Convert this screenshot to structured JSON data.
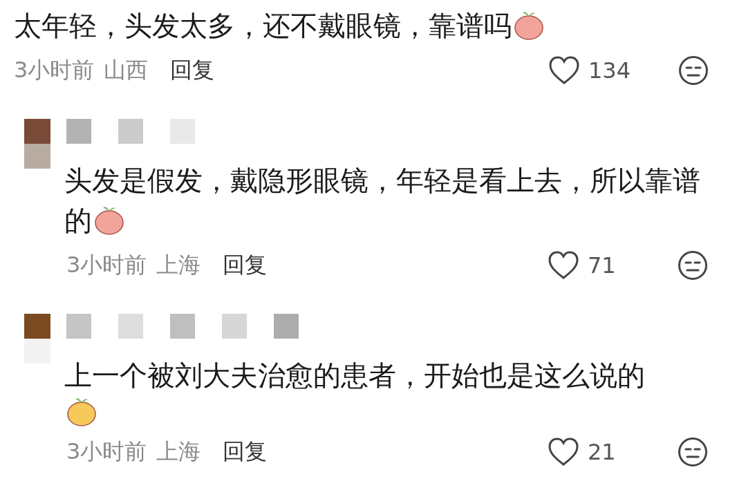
{
  "comment": {
    "text": "太年轻，头发太多，还不戴眼镜，靠谱吗",
    "sticker": {
      "color": "#f2a49a"
    },
    "time": "3小时前",
    "location": "山西",
    "reply_label": "回复",
    "likes": "134"
  },
  "replies": [
    {
      "text": "头发是假发，戴隐形眼镜，年轻是看上去，所以靠谱的",
      "sticker": {
        "color": "#f2a49a"
      },
      "time": "3小时前",
      "location": "上海",
      "reply_label": "回复",
      "likes": "71"
    },
    {
      "text": "上一个被刘大夫治愈的患者，开始也是这么说的",
      "sticker_below": {
        "color": "#f5c95a"
      },
      "time": "3小时前",
      "location": "上海",
      "reply_label": "回复",
      "likes": "21"
    }
  ]
}
